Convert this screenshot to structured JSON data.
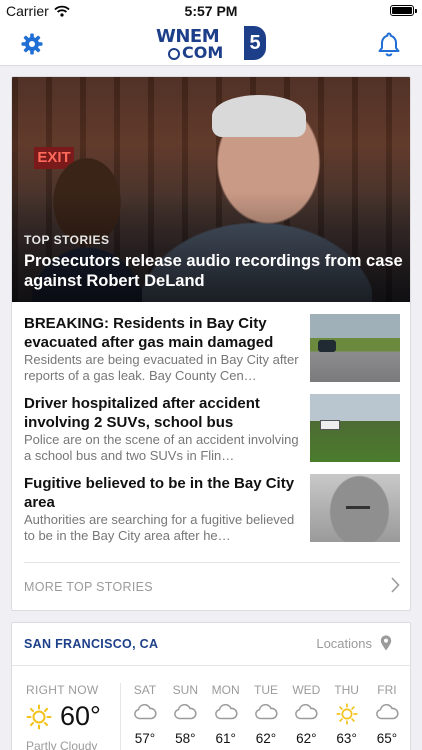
{
  "status_bar": {
    "carrier": "Carrier",
    "time": "5:57 PM"
  },
  "nav": {
    "logo_top": "WNEM",
    "logo_bottom": "COM",
    "logo_badge": "5"
  },
  "hero": {
    "kicker": "TOP STORIES",
    "headline": "Prosecutors release audio recordings from case against Robert DeLand",
    "sign": "EXIT"
  },
  "stories": [
    {
      "title": "BREAKING: Residents in Bay City evacuated after gas main damaged",
      "summary": "Residents are being evacuated in Bay City after reports of a gas leak. Bay County Cen…"
    },
    {
      "title": "Driver hospitalized after accident involving 2 SUVs, school bus",
      "summary": "Police are on the scene of an accident involving a school bus and two SUVs in Flin…"
    },
    {
      "title": "Fugitive believed to be in the Bay City area",
      "summary": "Authorities are searching for a fugitive believed to be in the Bay City area after he…"
    }
  ],
  "more_label": "MORE TOP STORIES",
  "weather": {
    "city": "SAN FRANCISCO, CA",
    "locations_label": "Locations",
    "now_label": "RIGHT NOW",
    "now_temp": "60°",
    "now_condition": "Partly Cloudy",
    "days": [
      {
        "name": "SAT",
        "temp": "57°",
        "icon": "cloud-icon"
      },
      {
        "name": "SUN",
        "temp": "58°",
        "icon": "cloud-icon"
      },
      {
        "name": "MON",
        "temp": "61°",
        "icon": "cloud-icon"
      },
      {
        "name": "TUE",
        "temp": "62°",
        "icon": "cloud-icon"
      },
      {
        "name": "WED",
        "temp": "62°",
        "icon": "cloud-icon"
      },
      {
        "name": "THU",
        "temp": "63°",
        "icon": "sun-icon"
      },
      {
        "name": "FRI",
        "temp": "65°",
        "icon": "cloud-icon"
      }
    ]
  },
  "colors": {
    "brand": "#1d3f8a",
    "icon_blue": "#1f6fd6",
    "sun_yellow": "#f2c21b"
  }
}
